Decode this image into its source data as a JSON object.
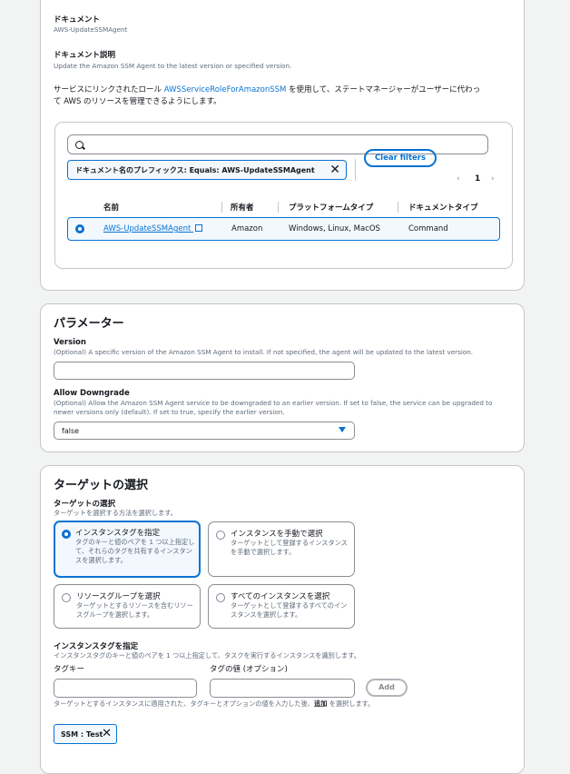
{
  "document": {
    "heading": "ドキュメント",
    "name": "AWS-UpdateSSMAgent",
    "desc_heading": "ドキュメント説明",
    "desc_text": "Update the Amazon SSM Agent to the latest version or specified version.",
    "service_text_prefix": "サービスにリンクされたロール ",
    "service_role_link": "AWSServiceRoleForAmazonSSM",
    "service_text_suffix": " を使用して、ステートマネージャーがユーザーに代わっ",
    "service_text_line2": "て AWS のリソースを管理できるようにします。"
  },
  "table": {
    "search_placeholder": "",
    "filter_token": "ドキュメント名のプレフィックス: Equals: AWS-UpdateSSMAgent",
    "clear_filters": "Clear filters",
    "page": "1",
    "columns": [
      "名前",
      "所有者",
      "プラットフォームタイプ",
      "ドキュメントタイプ"
    ],
    "row": {
      "name": "AWS-UpdateSSMAgent",
      "owner": "Amazon",
      "platform": "Windows, Linux, MacOS",
      "type": "Command"
    }
  },
  "params": {
    "title": "パラメーター",
    "version_label": "Version",
    "version_desc": "(Optional) A specific version of the Amazon SSM Agent to install. If not specified, the agent will be updated to the latest version.",
    "version_value": "",
    "downgrade_label": "Allow Downgrade",
    "downgrade_desc_1": "(Optional) Allow the Amazon SSM Agent service to be downgraded to an earlier version. If set to false, the service can be upgraded to",
    "downgrade_desc_2": "newer versions only (default). If set to true, specify the earlier version.",
    "downgrade_value": "false"
  },
  "targets": {
    "title": "ターゲットの選択",
    "label": "ターゲットの選択",
    "desc": "ターゲットを選択する方法を選択します。",
    "options": [
      {
        "title": "インスタンスタグを指定",
        "desc": "タグのキーと値のペアを 1 つ以上指定して、それらのタグを共有するインスタンスを選択します。",
        "selected": true
      },
      {
        "title": "インスタンスを手動で選択",
        "desc": "ターゲットとして登録するインスタンスを手動で選択します。",
        "selected": false
      },
      {
        "title": "リソースグループを選択",
        "desc": "ターゲットとするリソースを含むリソースグループを選択します。",
        "selected": false
      },
      {
        "title": "すべてのインスタンスを選択",
        "desc": "ターゲットとして登録するすべてのインスタンスを選択します。",
        "selected": false
      }
    ],
    "tags_label": "インスタンスタグを指定",
    "tags_desc": "インスタンスタグのキーと値のペアを 1 つ以上指定して、タスクを実行するインスタンスを識別します。",
    "tag_key_label": "タグキー",
    "tag_value_label": "タグの値 (オプション)",
    "tag_key_value": "",
    "tag_value_value": "",
    "add_button": "Add",
    "hint_prefix": "ターゲットとするインスタンスに適用された、タグキーとオプションの値を入力した後、",
    "hint_bold": "追加",
    "hint_suffix": " を選択します。",
    "token": "SSM : Test"
  },
  "colors": {
    "accent": "#0972d3",
    "border": "#c6c6cd",
    "background": "#f2f3f3"
  }
}
